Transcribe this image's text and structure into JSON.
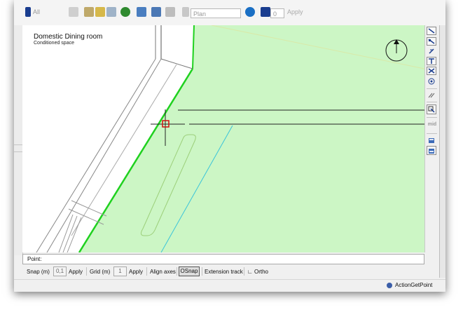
{
  "toolbar": {
    "selection_mode": "All",
    "view_select": "Plan",
    "snap_value": "0",
    "apply_label": "Apply"
  },
  "canvas": {
    "room_name": "Domestic Dining room",
    "room_type": "Conditioned space"
  },
  "side_tools": {
    "midpoint_label": "mid"
  },
  "command_line": {
    "prompt": "Point:",
    "value": ""
  },
  "snap_bar": {
    "snap_label": "Snap (m)",
    "snap_value": "0,1",
    "snap_apply": "Apply",
    "grid_label": "Grid (m)",
    "grid_value": "1",
    "grid_apply": "Apply",
    "align_axes": "Align axes",
    "osnap": "OSnap",
    "extension_track": "Extension track",
    "ortho": "Ortho"
  },
  "status": {
    "action": "ActionGetPoint"
  },
  "colors": {
    "zone_fill": "#ccf6c5",
    "zone_edge": "#1fd11f",
    "cursor": "#d01010",
    "accent_blue": "#1a3d8f"
  }
}
